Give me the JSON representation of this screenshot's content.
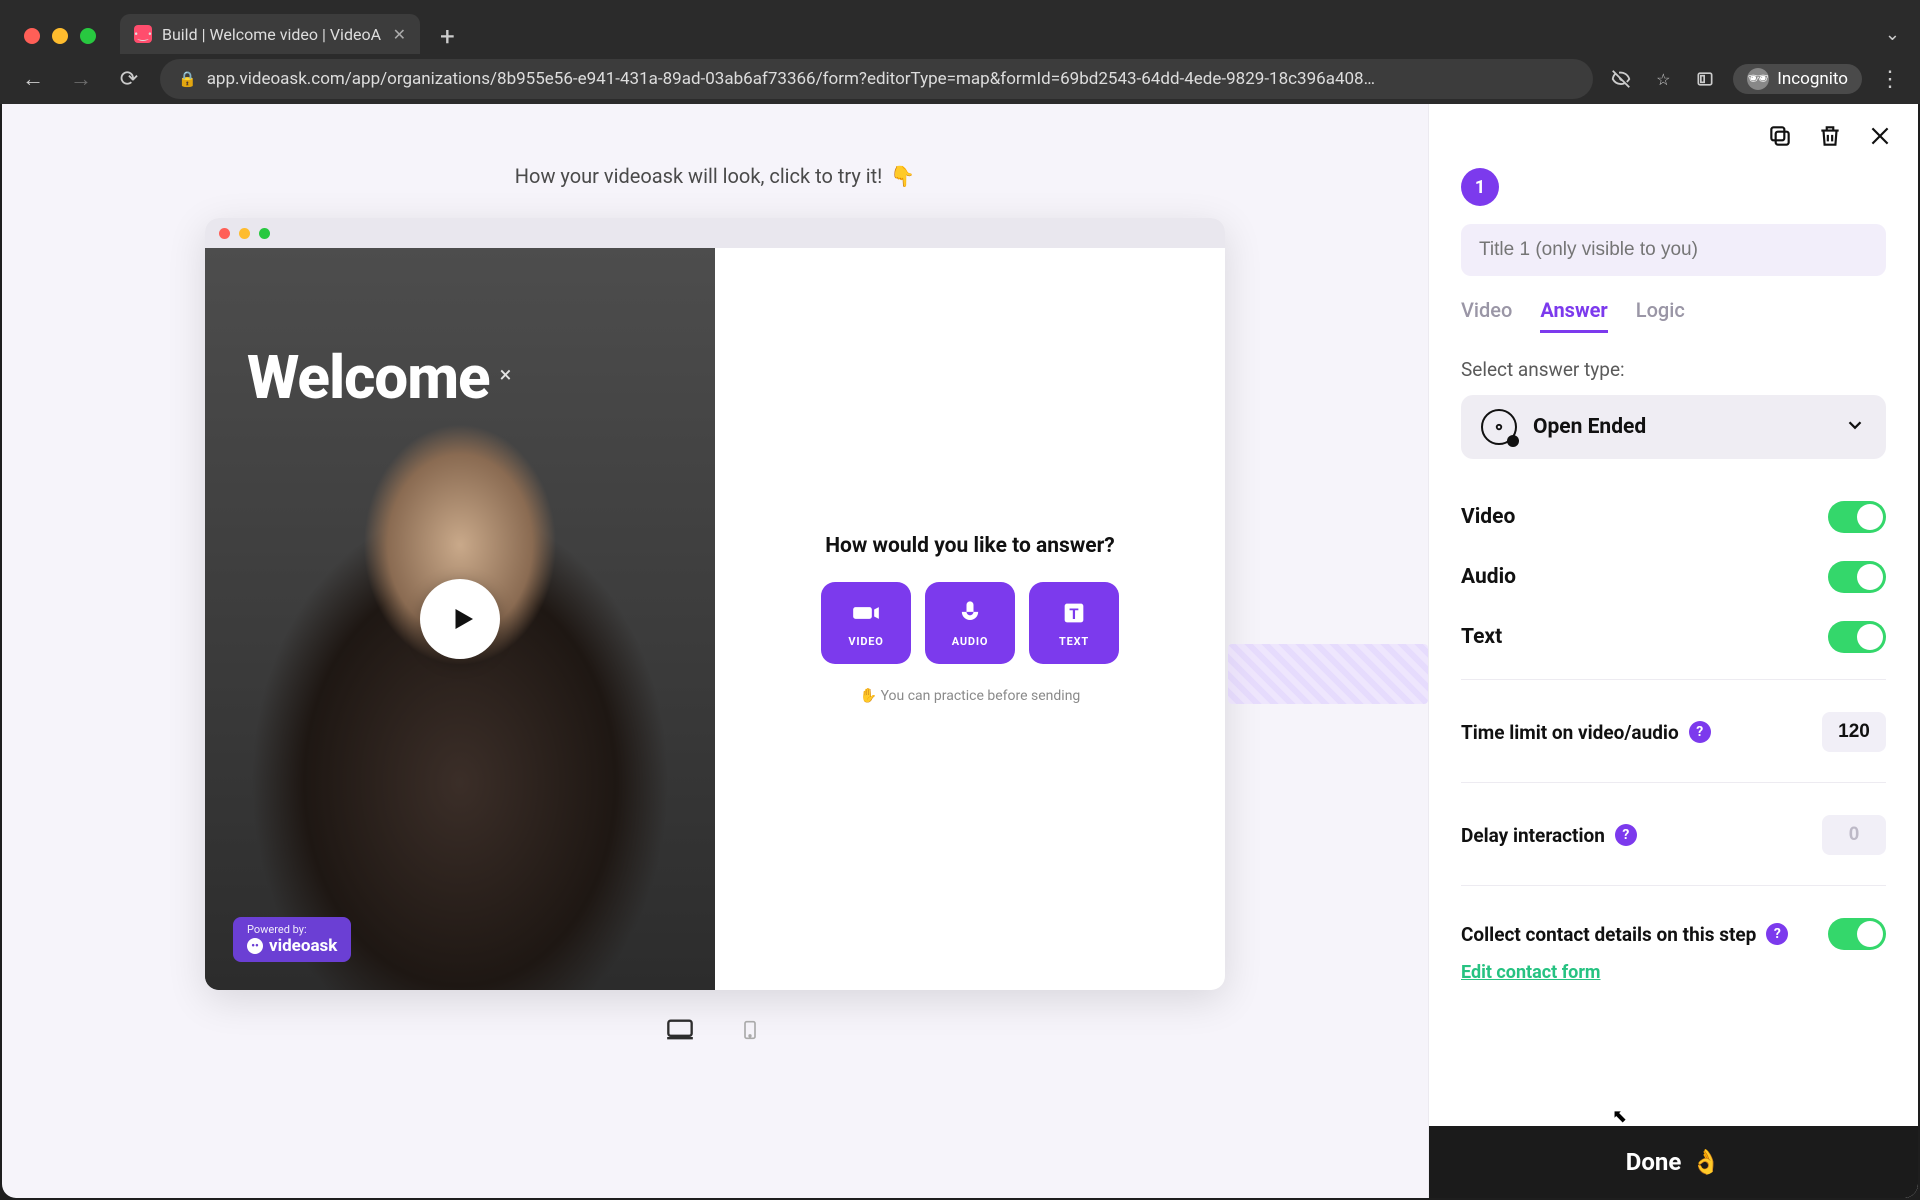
{
  "browser": {
    "tab_title": "Build | Welcome video | VideoA",
    "url": "app.videoask.com/app/organizations/8b955e56-e941-431a-89ad-03ab6af73366/form?editorType=map&formId=69bd2543-64dd-4ede-9829-18c396a408…",
    "incognito_label": "Incognito"
  },
  "preview": {
    "hint": "How your videoask will look, click to try it!",
    "hint_emoji": "👇",
    "video_title": "Welcome",
    "powered_top": "Powered by:",
    "powered_name": "videoask",
    "question": "How would you like to answer?",
    "options": {
      "video": "VIDEO",
      "audio": "AUDIO",
      "text": "TEXT"
    },
    "practice_note": "✋ You can practice before sending"
  },
  "editor": {
    "step_number": "1",
    "title_placeholder": "Title 1 (only visible to you)",
    "tabs": {
      "video": "Video",
      "answer": "Answer",
      "logic": "Logic"
    },
    "select_label": "Select answer type:",
    "answer_type": "Open Ended",
    "toggles": {
      "video": "Video",
      "audio": "Audio",
      "text": "Text"
    },
    "time_limit_label": "Time limit on video/audio",
    "time_limit_value": "120",
    "delay_label": "Delay interaction",
    "delay_value": "0",
    "collect_label": "Collect contact details on this step",
    "edit_contact": "Edit contact form",
    "done_label": "Done",
    "done_emoji": "👌"
  }
}
